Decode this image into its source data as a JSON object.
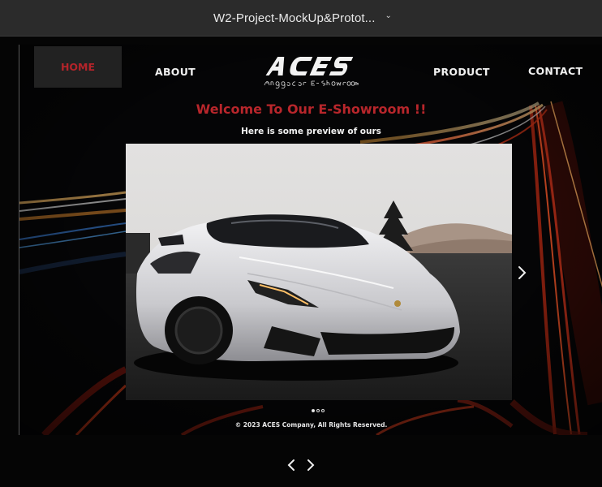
{
  "window": {
    "title": "W2-Project-MockUp&Protot...",
    "dropdown_icon": "chevron-down-icon"
  },
  "nav": {
    "home": "HOME",
    "about": "ABOUT",
    "product": "PRODUCT",
    "contact": "CONTACT",
    "active": "HOME"
  },
  "logo": {
    "text": "ACES",
    "tagline": "Angga Car E-Showroom"
  },
  "hero": {
    "welcome": "Welcome To Our E-Showroom !!",
    "subtitle": "Here is some preview of ours"
  },
  "carousel": {
    "current_slide": 1,
    "total_slides": 3,
    "next_icon": "chevron-right-icon"
  },
  "footer": {
    "copyright": "© 2023 ACES Company, All Rights Reserved."
  },
  "prototype_nav": {
    "prev_icon": "chevron-left-icon",
    "next_icon": "chevron-right-icon"
  },
  "colors": {
    "accent_red": "#b8262b",
    "topbar": "#2b2b2b",
    "background": "#000000",
    "text": "#f1f1f1"
  }
}
